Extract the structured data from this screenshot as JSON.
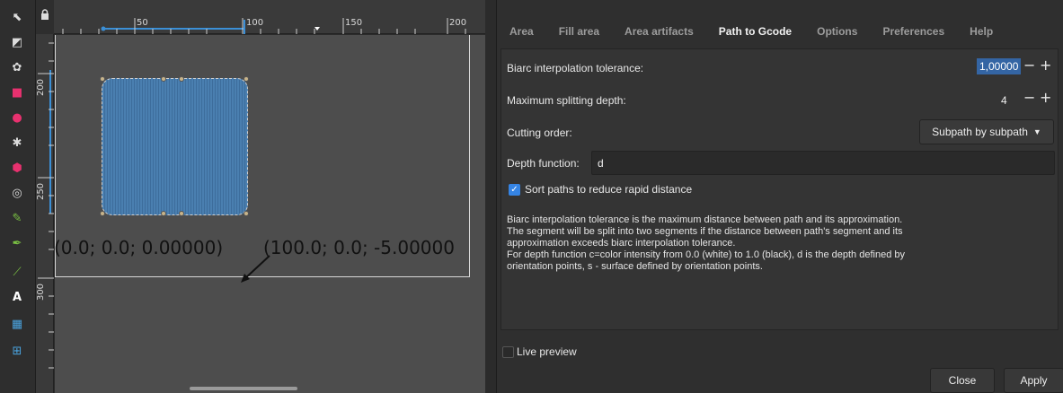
{
  "toolbox": {
    "tools": [
      {
        "name": "selector-icon",
        "glyph": "⬉"
      },
      {
        "name": "node-tool-icon",
        "glyph": "◩"
      },
      {
        "name": "tweak-tool-icon",
        "glyph": "✿"
      },
      {
        "name": "rectangle-tool-icon",
        "glyph": "■"
      },
      {
        "name": "circle-tool-icon",
        "glyph": "●"
      },
      {
        "name": "star-tool-icon",
        "glyph": "✱"
      },
      {
        "name": "box3d-tool-icon",
        "glyph": "⬢"
      },
      {
        "name": "spiral-tool-icon",
        "glyph": "◎"
      },
      {
        "name": "pencil-tool-icon",
        "glyph": "✎"
      },
      {
        "name": "pen-tool-icon",
        "glyph": "✒"
      },
      {
        "name": "calligraphy-tool-icon",
        "glyph": "⟋"
      },
      {
        "name": "text-tool-icon",
        "glyph": "A"
      },
      {
        "name": "gradient-tool-icon",
        "glyph": "▦"
      },
      {
        "name": "mesh-tool-icon",
        "glyph": "⊞"
      }
    ],
    "colors": {
      "rect": "#e8316f",
      "circle": "#e8316f",
      "box": "#e8316f",
      "gradient": "#4aa3df",
      "pencil": "#7ac143"
    }
  },
  "ruler": {
    "h_labels": [
      "50",
      "100",
      "150",
      "200"
    ],
    "v_labels": [
      "200",
      "250",
      "300"
    ]
  },
  "canvas": {
    "text_left": "(0.0; 0.0; 0.00000)",
    "text_right": "(100.0; 0.0; -5.00000"
  },
  "dialog": {
    "tabs": [
      {
        "label": "Area",
        "active": false
      },
      {
        "label": "Fill area",
        "active": false
      },
      {
        "label": "Area artifacts",
        "active": false
      },
      {
        "label": "Path to Gcode",
        "active": true
      },
      {
        "label": "Options",
        "active": false
      },
      {
        "label": "Preferences",
        "active": false
      },
      {
        "label": "Help",
        "active": false
      }
    ],
    "biarc_label": "Biarc interpolation tolerance:",
    "biarc_value": "1,00000",
    "depth_label": "Maximum splitting depth:",
    "depth_value": "4",
    "minus": "−",
    "plus": "+",
    "cutting_label": "Cutting order:",
    "cutting_value": "Subpath by subpath",
    "depth_function_label": "Depth function:",
    "depth_function_value": "d",
    "sort_label": "Sort paths to reduce rapid distance",
    "sort_checked": true,
    "description": [
      "Biarc interpolation tolerance is the maximum distance between path and its approximation.",
      "The segment will be split into two segments if the distance between path's segment and its",
      "approximation exceeds biarc interpolation tolerance.",
      "For depth function c=color intensity from 0.0 (white) to 1.0 (black), d is the depth defined by",
      "orientation points, s - surface defined by orientation points."
    ],
    "live_preview_label": "Live preview",
    "live_preview_checked": false,
    "close_label": "Close",
    "apply_label": "Apply"
  },
  "colors": {
    "accent": "#3584e4",
    "selection": "#3465a4",
    "canvas": "#4d4d4d",
    "shape": "#4a7fb0"
  }
}
